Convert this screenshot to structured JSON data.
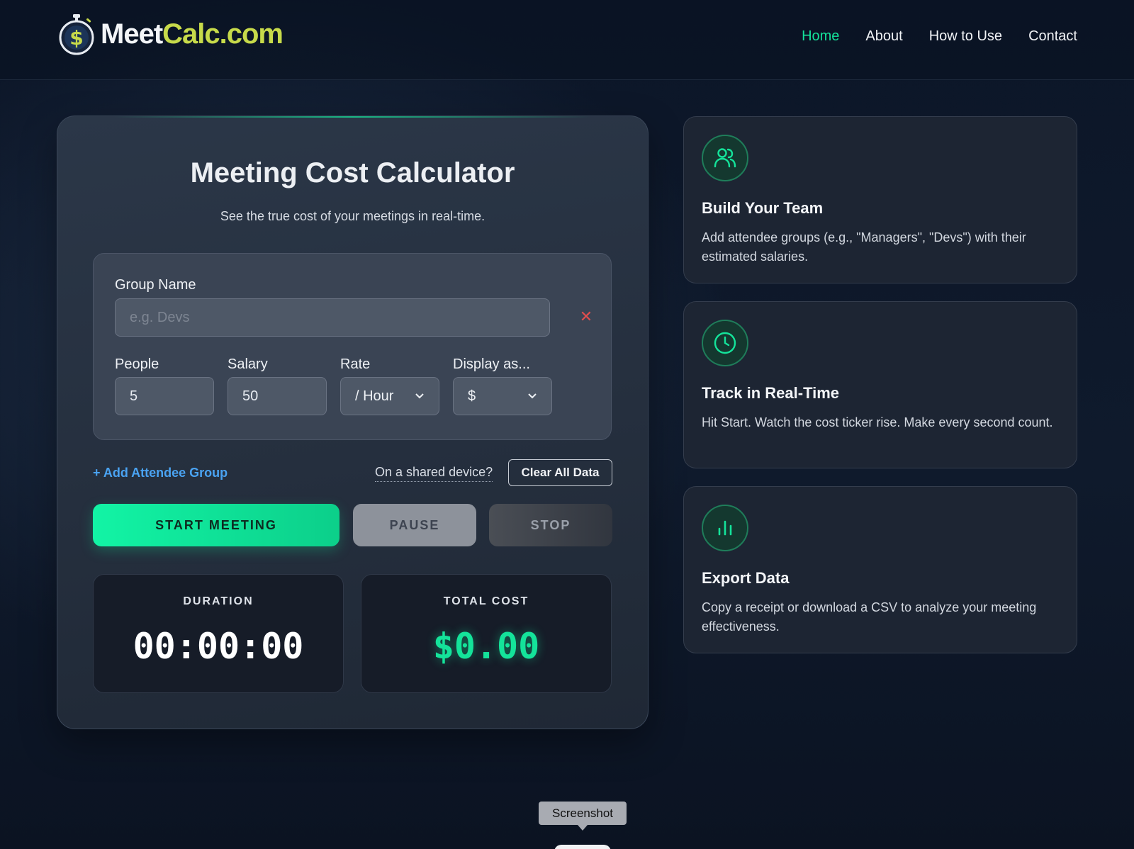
{
  "brand": {
    "name_part1": "Meet",
    "name_part2": "Calc.com",
    "accent": "#c7da4a"
  },
  "nav": {
    "items": [
      {
        "label": "Home",
        "active": true
      },
      {
        "label": "About",
        "active": false
      },
      {
        "label": "How to Use",
        "active": false
      },
      {
        "label": "Contact",
        "active": false
      }
    ]
  },
  "calculator": {
    "title": "Meeting Cost Calculator",
    "subtitle": "See the true cost of your meetings in real-time.",
    "group": {
      "name_label": "Group Name",
      "name_placeholder": "e.g. Devs",
      "name_value": "",
      "remove_icon": "close-icon",
      "people_label": "People",
      "people_value": "5",
      "salary_label": "Salary",
      "salary_value": "50",
      "rate_label": "Rate",
      "rate_value": "/ Hour",
      "display_label": "Display as...",
      "display_value": "$"
    },
    "add_group_label": "+ Add Attendee Group",
    "shared_device_text": "On a shared device?",
    "clear_label": "Clear All Data",
    "start_label": "START MEETING",
    "pause_label": "PAUSE",
    "stop_label": "STOP",
    "duration_label": "DURATION",
    "duration_value": "00:00:00",
    "cost_label": "TOTAL COST",
    "cost_value": "$0.00",
    "accent": "#14e39a"
  },
  "features": [
    {
      "icon": "users-icon",
      "title": "Build Your Team",
      "text": "Add attendee groups (e.g., \"Managers\", \"Devs\") with their estimated salaries."
    },
    {
      "icon": "clock-icon",
      "title": "Track in Real-Time",
      "text": "Hit Start. Watch the cost ticker rise. Make every second count."
    },
    {
      "icon": "bar-chart-icon",
      "title": "Export Data",
      "text": "Copy a receipt or download a CSV to analyze your meeting effectiveness."
    }
  ],
  "tooltip": {
    "label": "Screenshot"
  }
}
